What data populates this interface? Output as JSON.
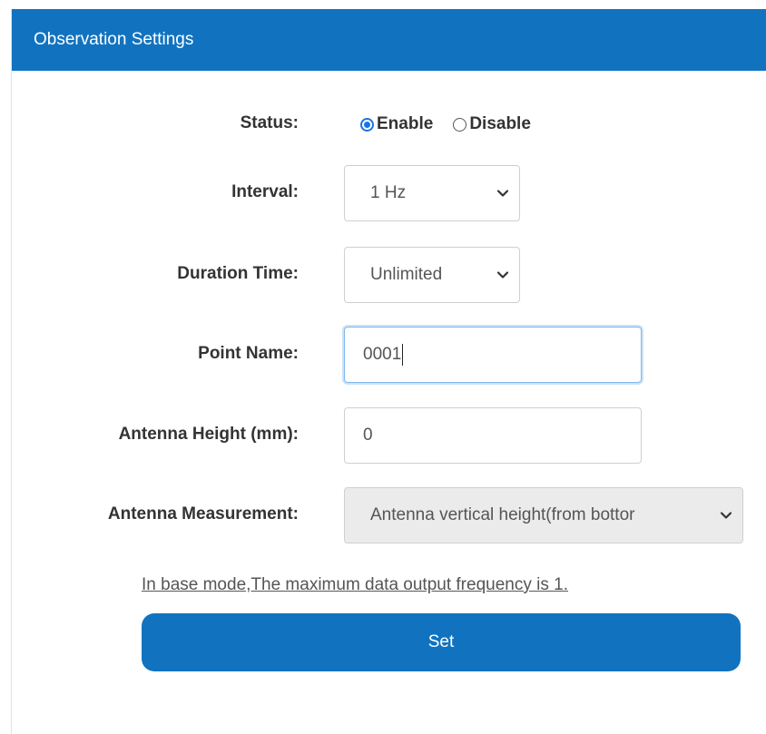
{
  "panel": {
    "title": "Observation Settings"
  },
  "form": {
    "status": {
      "label": "Status:",
      "options": [
        "Enable",
        "Disable"
      ],
      "selected": "Enable"
    },
    "interval": {
      "label": "Interval:",
      "value": "1 Hz"
    },
    "duration": {
      "label": "Duration Time:",
      "value": "Unlimited"
    },
    "point_name": {
      "label": "Point Name:",
      "value": "0001"
    },
    "antenna_height": {
      "label": "Antenna Height (mm):",
      "value": "0"
    },
    "antenna_measurement": {
      "label": "Antenna Measurement:",
      "value": "Antenna vertical height(from bottor"
    },
    "note": "In base mode,The maximum data output frequency is 1.",
    "set_button": "Set"
  },
  "colors": {
    "header_bg": "#1173c0",
    "button_bg": "#1173c0",
    "radio_accent": "#1a73e8"
  },
  "icons": {
    "dropdown": "chevron-down-icon"
  }
}
